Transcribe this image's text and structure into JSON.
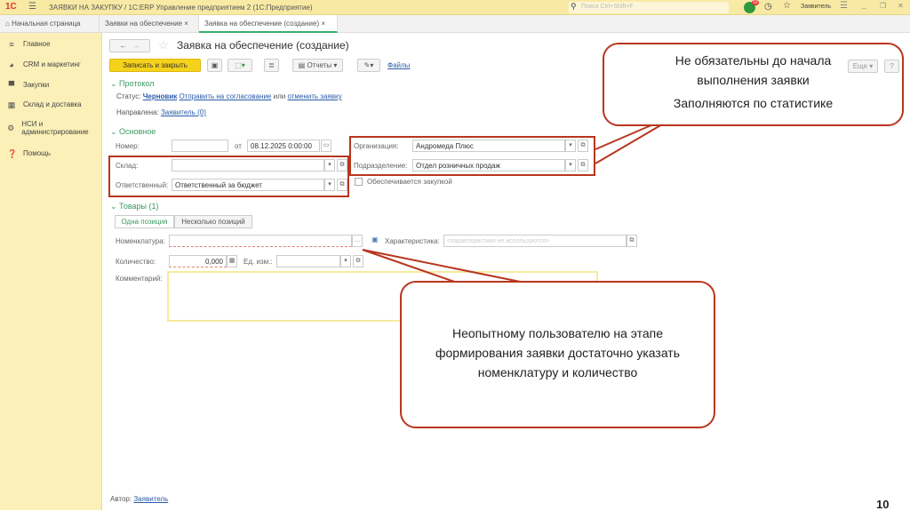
{
  "titlebar": {
    "logo": "1С",
    "title": "ЗАЯВКИ НА ЗАКУПКУ / 1С:ERP Управление предприятием 2  (1С:Предприятие)",
    "search_placeholder": "Поиск Ctrl+Shift+F",
    "notif_count": "10",
    "user": "Заявитель"
  },
  "tabs": [
    {
      "label": "Начальная страница"
    },
    {
      "label": "Заявки на обеспечение"
    },
    {
      "label": "Заявка на обеспечение (создание)"
    }
  ],
  "sidebar": {
    "items": [
      {
        "label": "Главное",
        "icon": "menu-icon"
      },
      {
        "label": "CRM и маркетинг",
        "icon": "pie-icon"
      },
      {
        "label": "Закупки",
        "icon": "cart-icon"
      },
      {
        "label": "Склад и доставка",
        "icon": "grid-icon"
      },
      {
        "label": "НСИ и администрирование",
        "icon": "gear-icon"
      },
      {
        "label": "Помощь",
        "icon": "help-icon"
      }
    ]
  },
  "form": {
    "title": "Заявка на обеспечение (создание)",
    "toolbar": {
      "save_close": "Записать и закрыть",
      "reports": "Отчеты",
      "files": "Файлы",
      "more": "Еще",
      "help": "?"
    },
    "protocol": {
      "header": "Протокол",
      "status_label": "Статус:",
      "status_value": "Черновик",
      "send_link": "Отправить на согласование",
      "or": "или",
      "cancel_link": "отменить заявку",
      "directed_label": "Направлена:",
      "directed_value": "Заявитель (0)"
    },
    "main": {
      "header": "Основное",
      "number_label": "Номер:",
      "number_value": "",
      "from_label": "от",
      "date_value": "08.12.2025  0:00:00",
      "org_label": "Организация:",
      "org_value": "Андромеда Плюс",
      "warehouse_label": "Склад:",
      "warehouse_value": "",
      "dept_label": "Подразделение:",
      "dept_value": "Отдел розничных продаж",
      "resp_label": "Ответственный:",
      "resp_value": "Ответственный за бюджет",
      "purchase_checkbox": "Обеспечивается закупкой"
    },
    "goods": {
      "header": "Товары (1)",
      "tab_one": "Одна позиция",
      "tab_many": "Несколько позиций",
      "nom_label": "Номенклатура:",
      "char_label": "Характеристика:",
      "char_placeholder": "<характеристики не используются>",
      "qty_label": "Количество:",
      "qty_value": "0,000",
      "unit_label": "Ед. изм.:",
      "comment_label": "Комментарий:"
    },
    "author_label": "Автор:",
    "author_value": "Заявитель"
  },
  "callouts": {
    "top_line1": "Не обязательны до начала",
    "top_line2": "выполнения заявки",
    "top_line3": "Заполняются по статистике",
    "bottom": "Неопытному пользователю на этапе формирования заявки достаточно указать номенклатуру и количество"
  },
  "slide_number": "10",
  "colors": {
    "accent": "#b8361f",
    "sidebar": "#fbf0b8",
    "save_button": "#f5d21b",
    "section": "#3a9a63"
  }
}
